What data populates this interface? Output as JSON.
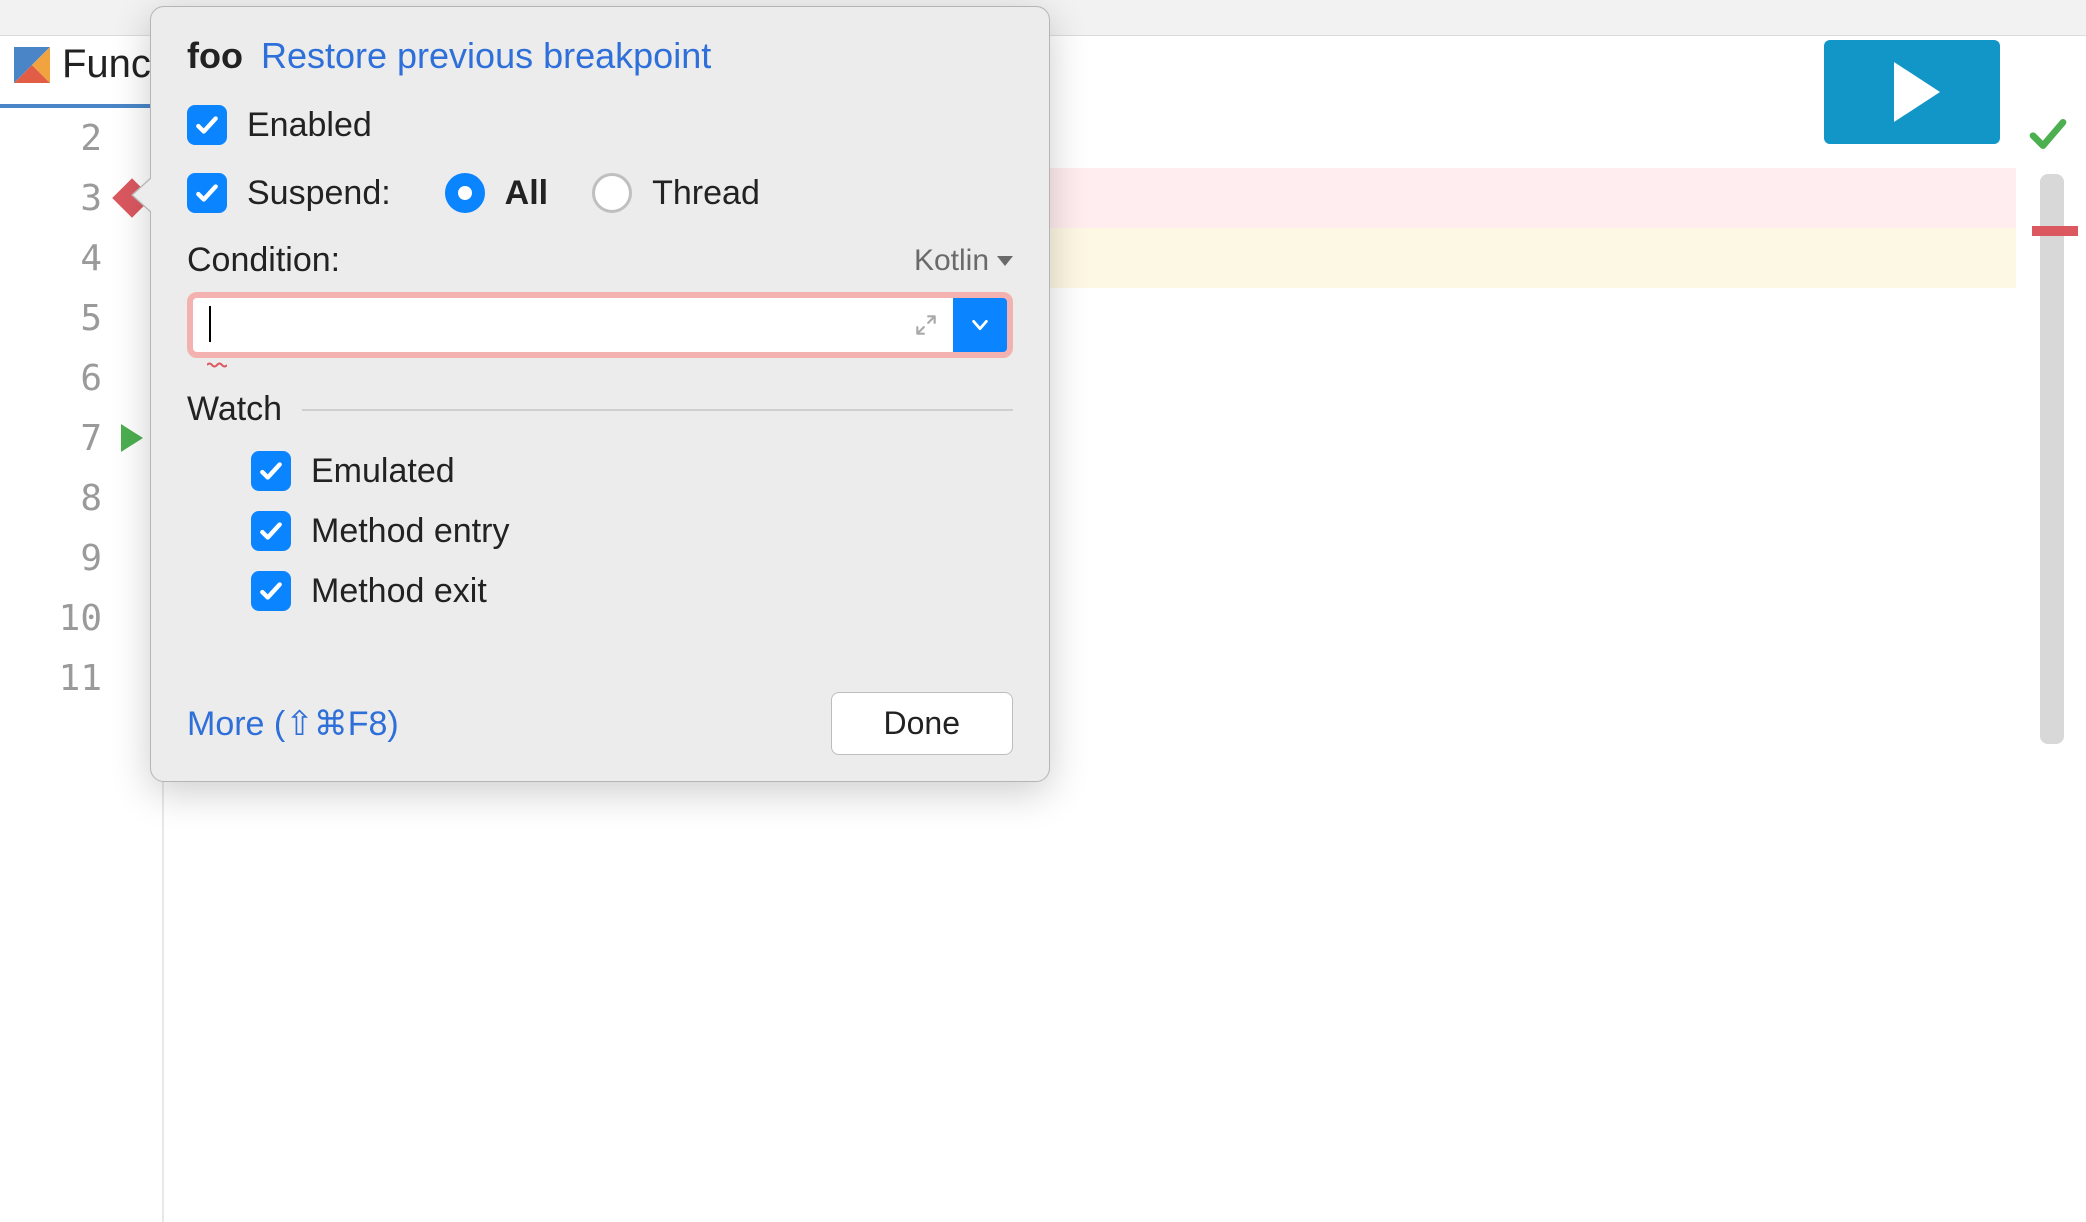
{
  "tab": {
    "label": "Funct"
  },
  "gutter": {
    "lines": [
      "2",
      "3",
      "4",
      "5",
      "6",
      "7",
      "8",
      "9",
      "10",
      "11"
    ],
    "breakpoint_line": "3",
    "run_line": "7"
  },
  "popover": {
    "name": "foo",
    "restore_link": "Restore previous breakpoint",
    "enabled_label": "Enabled",
    "suspend_label": "Suspend:",
    "suspend_all": "All",
    "suspend_thread": "Thread",
    "condition_label": "Condition:",
    "condition_lang": "Kotlin",
    "condition_value": "",
    "watch_header": "Watch",
    "watch_emulated": "Emulated",
    "watch_method_entry": "Method entry",
    "watch_method_exit": "Method exit",
    "more_label": "More (⇧⌘F8)",
    "done_label": "Done"
  },
  "icons": {
    "kotlin": "kotlin-file-icon",
    "play": "play-icon",
    "check": "check-icon"
  },
  "colors": {
    "accent": "#0a84ff",
    "link": "#2e6fd9",
    "play_bg": "#1296c8",
    "breakpoint": "#db5860"
  }
}
